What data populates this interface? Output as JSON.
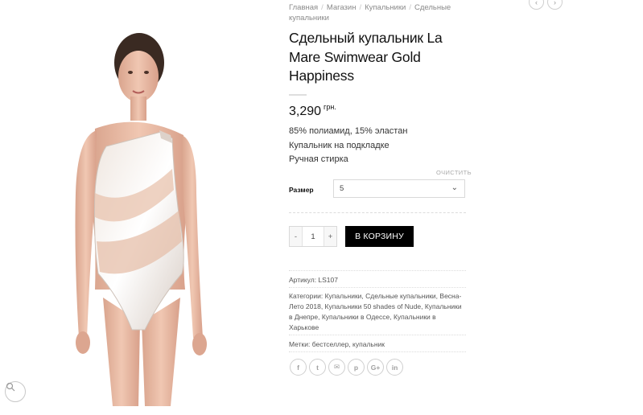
{
  "breadcrumb": {
    "items": [
      "Главная",
      "Магазин",
      "Купальники",
      "Сдельные купальники"
    ],
    "separator": "/"
  },
  "nav": {
    "prev_icon": "chevron-left-icon",
    "next_icon": "chevron-right-icon"
  },
  "product": {
    "title": "Сдельный купальник La Mare Swimwear Gold Happiness",
    "price": "3,290",
    "currency": "грн.",
    "description": [
      "85% полиамид, 15% эластан",
      "Купальник на подкладке",
      "Ручная стирка"
    ]
  },
  "variations": {
    "clear_label": "ОЧИСТИТЬ",
    "size_label": "Размер",
    "size_value": "5"
  },
  "cart": {
    "minus_label": "-",
    "quantity": "1",
    "plus_label": "+",
    "add_button_label": "В КОРЗИНУ"
  },
  "meta": {
    "sku_text": "Артикул: LS107",
    "categories_text": "Категории: Купальники, Сдельные купальники, Весна-Лето 2018, Купальники 50 shades of Nude, Купальники в Днепре, Купальники в Одессе, Купальники в Харькове",
    "tags_text": "Метки: бестселлер, купальник"
  },
  "share": {
    "icons": [
      {
        "name": "facebook-icon",
        "glyph": "f"
      },
      {
        "name": "twitter-icon",
        "glyph": "t"
      },
      {
        "name": "email-icon",
        "glyph": "✉"
      },
      {
        "name": "pinterest-icon",
        "glyph": "p"
      },
      {
        "name": "google-plus-icon",
        "glyph": "G+"
      },
      {
        "name": "linkedin-icon",
        "glyph": "in"
      }
    ]
  },
  "gallery": {
    "zoom_icon": "zoom-icon"
  },
  "colors": {
    "button_bg": "#000000",
    "accent_text": "#111111",
    "muted": "#8a8a8a"
  }
}
